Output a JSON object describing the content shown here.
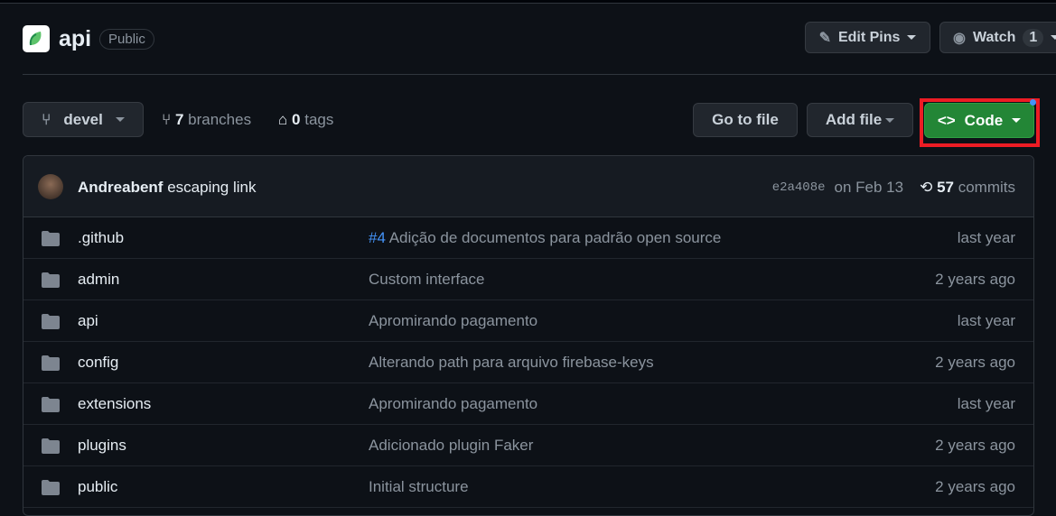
{
  "repo": {
    "name": "api",
    "visibility": "Public"
  },
  "header": {
    "edit_pins": "Edit Pins",
    "watch": "Watch",
    "watch_count": "1"
  },
  "branch_bar": {
    "branch": "devel",
    "branch_count": "7",
    "branches_label": "branches",
    "tag_count": "0",
    "tags_label": "tags",
    "go_to_file": "Go to file",
    "add_file": "Add file",
    "code": "Code"
  },
  "commit": {
    "author": "Andreabenf",
    "message": "escaping link",
    "sha": "e2a408e",
    "date": "on Feb 13",
    "count": "57",
    "count_label": "commits"
  },
  "files": [
    {
      "name": ".github",
      "issue": "#4",
      "message": "Adição de documentos para padrão open source",
      "time": "last year"
    },
    {
      "name": "admin",
      "issue": "",
      "message": "Custom interface",
      "time": "2 years ago"
    },
    {
      "name": "api",
      "issue": "",
      "message": "Apromirando pagamento",
      "time": "last year"
    },
    {
      "name": "config",
      "issue": "",
      "message": "Alterando path para arquivo firebase-keys",
      "time": "2 years ago"
    },
    {
      "name": "extensions",
      "issue": "",
      "message": "Apromirando pagamento",
      "time": "last year"
    },
    {
      "name": "plugins",
      "issue": "",
      "message": "Adicionado plugin Faker",
      "time": "2 years ago"
    },
    {
      "name": "public",
      "issue": "",
      "message": "Initial structure",
      "time": "2 years ago"
    }
  ],
  "colors": {
    "code_button": "#238636",
    "highlight": "#ed1c24",
    "link": "#4493f8"
  }
}
